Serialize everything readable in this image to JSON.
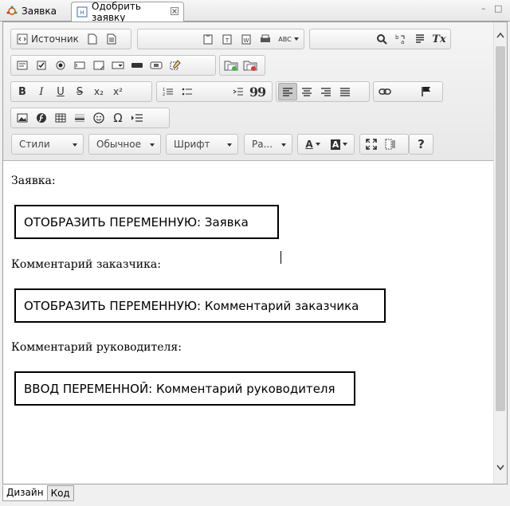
{
  "tabs": [
    {
      "label": "Заявка",
      "icon": "workflow-icon",
      "active": false
    },
    {
      "label": "Одобрить заявку",
      "icon": "html-form-icon",
      "active": true
    }
  ],
  "window_controls": {
    "minimize": "–",
    "maximize": "□"
  },
  "toolbar": {
    "source_label": "Источник",
    "styles_combo": "Стили",
    "format_combo": "Обычное",
    "font_combo": "Шрифт",
    "size_combo": "Ра...",
    "help_label": "?",
    "omega_label": "Ω",
    "superscript_label": "x²",
    "subscript_label": "x₂",
    "quote_label": "99",
    "bold_label": "B",
    "italic_label": "I",
    "underline_label": "U",
    "strike_label": "S",
    "abc_label": "ABC",
    "clear_format_label": "Tx",
    "text_color_label": "A",
    "bg_color_label": "A"
  },
  "content": {
    "label1": "Заявка:",
    "var1": "ОТОБРАЗИТЬ ПЕРЕМЕННУЮ: Заявка",
    "label2": "Комментарий заказчика:",
    "var2": "ОТОБРАЗИТЬ ПЕРЕМЕННУЮ: Комментарий заказчика",
    "label3": "Комментарий руководителя:",
    "var3": "ВВОД ПЕРЕМЕННОЙ: Комментарий руководителя"
  },
  "bottom_tabs": [
    {
      "label": "Дизайн",
      "active": true
    },
    {
      "label": "Код",
      "active": false
    }
  ],
  "colors": {
    "accent_blue": "#3a6ea5",
    "toolbar_bg": "#ececec",
    "active_btn": "#c9c9c9"
  }
}
